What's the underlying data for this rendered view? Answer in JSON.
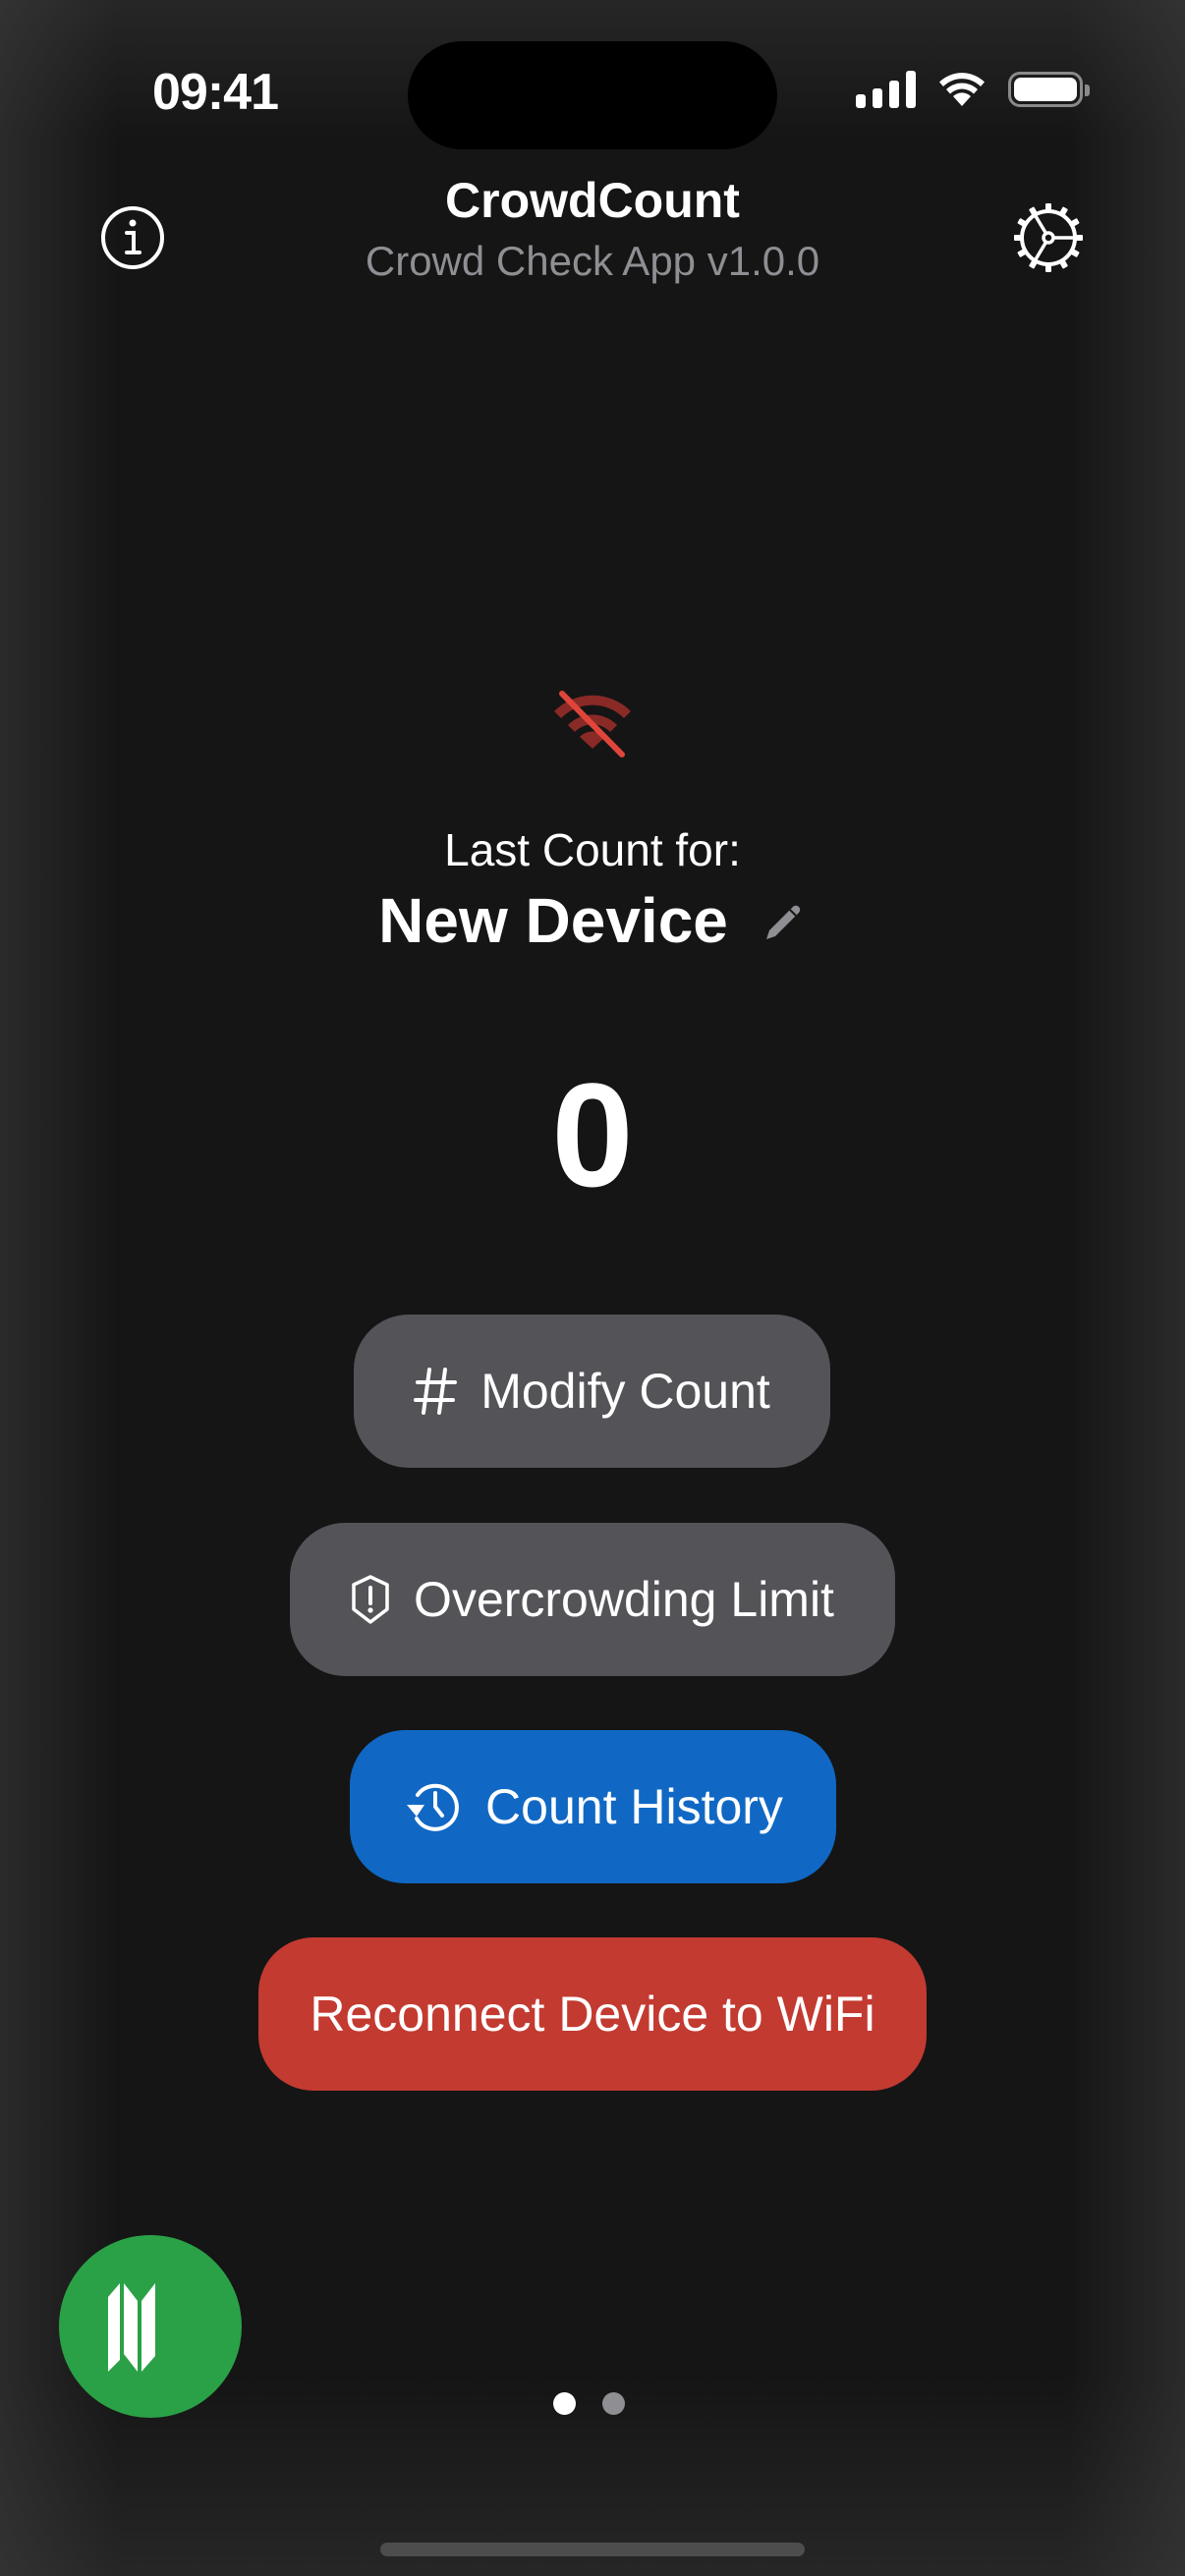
{
  "status_bar": {
    "time": "09:41",
    "signal_icon": "cellular-signal-icon",
    "wifi_icon": "wifi-icon",
    "battery_icon": "battery-full-icon"
  },
  "header": {
    "title": "CrowdCount",
    "subtitle": "Crowd Check App v1.0.0",
    "left_icon": "info-icon",
    "right_icon": "settings-gear-icon"
  },
  "connection": {
    "status_icon": "wifi-slash-icon",
    "status": "disconnected",
    "status_color": "#e0453c"
  },
  "device": {
    "label": "Last Count for:",
    "name": "New Device",
    "edit_icon": "pencil-icon"
  },
  "count": {
    "value": "0"
  },
  "actions": {
    "modify": {
      "label": "Modify Count",
      "icon": "number-sign-icon",
      "color": "#545358"
    },
    "limit": {
      "label": "Overcrowding Limit",
      "icon": "shield-exclamation-icon",
      "color": "#545358"
    },
    "history": {
      "label": "Count History",
      "icon": "clock-history-icon",
      "color": "#1068c4"
    },
    "reconnect": {
      "label": "Reconnect Device to WiFi",
      "color": "#c33a31"
    }
  },
  "map_button": {
    "icon": "map-icon",
    "color": "#2aa147"
  },
  "pagination": {
    "total": 2,
    "current": 1
  }
}
